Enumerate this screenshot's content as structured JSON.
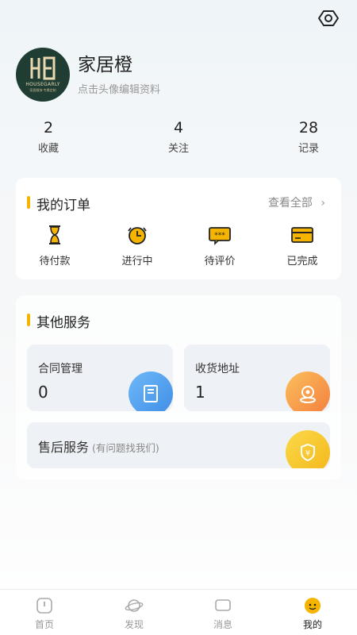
{
  "profile": {
    "name": "家居橙",
    "edit_hint": "点击头像编辑资料",
    "avatar_brand": "HOUSEGARLY",
    "avatar_sub": "家居服饰·专属定制"
  },
  "stats": [
    {
      "value": "2",
      "label": "收藏"
    },
    {
      "value": "4",
      "label": "关注"
    },
    {
      "value": "28",
      "label": "记录"
    }
  ],
  "orders": {
    "title": "我的订单",
    "view_all": "查看全部",
    "items": [
      {
        "label": "待付款",
        "icon": "hourglass-icon"
      },
      {
        "label": "进行中",
        "icon": "clock-icon"
      },
      {
        "label": "待评价",
        "icon": "comment-icon"
      },
      {
        "label": "已完成",
        "icon": "card-icon"
      }
    ]
  },
  "services": {
    "title": "其他服务",
    "contract": {
      "title": "合同管理",
      "value": "0"
    },
    "address": {
      "title": "收货地址",
      "value": "1"
    },
    "after_sales": {
      "title": "售后服务",
      "hint": "(有问题找我们)"
    }
  },
  "tabs": [
    {
      "label": "首页",
      "icon": "home-icon"
    },
    {
      "label": "发现",
      "icon": "planet-icon"
    },
    {
      "label": "消息",
      "icon": "message-icon"
    },
    {
      "label": "我的",
      "icon": "profile-icon"
    }
  ],
  "colors": {
    "accent": "#f5b400",
    "contract_badge": "#4a9ff0",
    "address_badge": "#f7a04b",
    "after_sales_badge": "#f8c820"
  }
}
